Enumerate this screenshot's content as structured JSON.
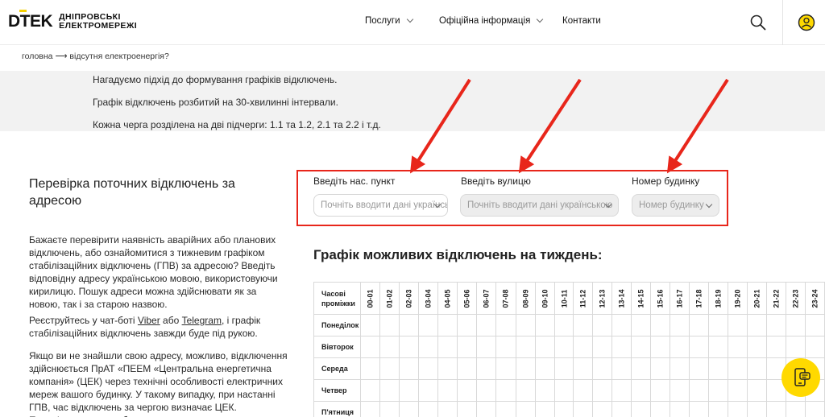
{
  "header": {
    "logo_mark": "DTEK",
    "logo_line1": "ДНІПРОВСЬКІ",
    "logo_line2": "ЕЛЕКТРОМЕРЕЖІ",
    "nav": [
      {
        "label": "Послуги",
        "dropdown": true
      },
      {
        "label": "Офіційна інформація",
        "dropdown": true
      },
      {
        "label": "Контакти",
        "dropdown": false
      }
    ],
    "search_icon": "search-icon",
    "user_icon": "user-icon"
  },
  "breadcrumb": {
    "home": "головна",
    "separator": "⟶",
    "current": "відсутня електроенергія?"
  },
  "info": {
    "lines": [
      "Нагадуємо підхід до формування графіків відключень.",
      "Графік відключень розбитий на 30-хвилинні інтервали.",
      "Кожна черга розділена на дві підчерги: 1.1 та 1.2, 2.1 та 2.2 і т.д."
    ]
  },
  "left": {
    "title": "Перевірка поточних відключень за адресою",
    "p1": "Бажаєте перевірити наявність аварійних або планових відключень, або ознайомитися з тижневим графіком стабілізаційних відключень (ГПВ) за адресою? Введіть відповідну адресу українською мовою, використовуючи кирилицю. Пошук адреси можна здійснювати як за новою, так і за старою назвою.",
    "p2_before": "Реєструйтесь у чат-боті ",
    "p2_link1": "Viber",
    "p2_mid": " або ",
    "p2_link2": "Telegram",
    "p2_after": ", і графік стабілізаційних відключень завжди буде під рукою.",
    "p3": "Якщо ви не знайшли свою адресу, можливо, відключення здійснюється ПрАТ «ПЕЕМ «Центральна енергетична компанія» (ЦЕК) через технічні особливості електричних мереж вашого будинку. У такому випадку, при настанні ГПВ, час відключень за чергою визначає ЦЕК. Перевірити адресу обслуговування"
  },
  "form": {
    "city_label": "Введіть нас. пункт",
    "city_placeholder": "Почніть вводити дані українською",
    "street_label": "Введіть вулицю",
    "street_placeholder": "Почніть вводити дані українською",
    "house_label": "Номер будинку",
    "house_placeholder": "Номер будинку",
    "highlight_color": "#e8261b"
  },
  "schedule": {
    "title": "Графік можливих відключень на тиждень:",
    "corner_line1": "Часові",
    "corner_line2": "проміжки",
    "hours": [
      "00-01",
      "01-02",
      "02-03",
      "03-04",
      "04-05",
      "05-06",
      "06-07",
      "07-08",
      "08-09",
      "09-10",
      "10-11",
      "11-12",
      "12-13",
      "13-14",
      "14-15",
      "15-16",
      "16-17",
      "17-18",
      "18-19",
      "19-20",
      "20-21",
      "21-22",
      "22-23",
      "23-24"
    ],
    "days": [
      "Понеділок",
      "Вівторок",
      "Середа",
      "Четвер",
      "П'ятниця"
    ]
  },
  "chat": {
    "icon": "chat-phone-icon",
    "color": "#ffd900"
  }
}
